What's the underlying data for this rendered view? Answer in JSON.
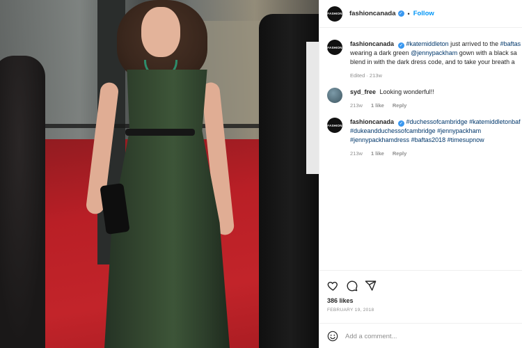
{
  "post": {
    "username": "fashioncanada",
    "follow_label": "Follow",
    "separator": "•",
    "avatar_text": "FASHION"
  },
  "comments": [
    {
      "username": "fashioncanada",
      "segments": [
        {
          "text": "#katemiddleton",
          "tag": true
        },
        {
          "text": " just arrived to the ",
          "tag": false
        },
        {
          "text": "#baftas",
          "tag": true
        }
      ],
      "line2_segments": [
        {
          "text": "wearing a dark green ",
          "tag": false
        },
        {
          "text": "@jennypackham",
          "tag": true
        },
        {
          "text": " gown with a black sa",
          "tag": false
        }
      ],
      "line3": "blend in with the dark dress code, and to take your breath a",
      "meta_time": "Edited · 213w"
    },
    {
      "username": "syd_free",
      "text": "Looking wonderful!!",
      "meta_time": "213w",
      "likes": "1 like",
      "reply": "Reply"
    },
    {
      "username": "fashioncanada",
      "line1_tags": [
        "#duchessofcambridge",
        "#katemiddletonbaf"
      ],
      "line2_tags": [
        "#dukeandduchessofcambridge",
        "#jennypackham"
      ],
      "line3_tags": [
        "#jennypackhamdress",
        "#baftas2018",
        "#timesupnow"
      ],
      "meta_time": "213w",
      "likes": "1 like",
      "reply": "Reply"
    }
  ],
  "actions": {
    "likes_count": "386 likes",
    "date": "FEBRUARY 19, 2018",
    "comment_placeholder": "Add a comment..."
  },
  "colors": {
    "link_blue": "#0095f6",
    "tag_blue": "#00376b",
    "verified_blue": "#3897f0",
    "muted": "#8e8e8e"
  },
  "icons": [
    "heart-icon",
    "comment-icon",
    "share-icon",
    "emoji-icon",
    "verified-icon"
  ]
}
